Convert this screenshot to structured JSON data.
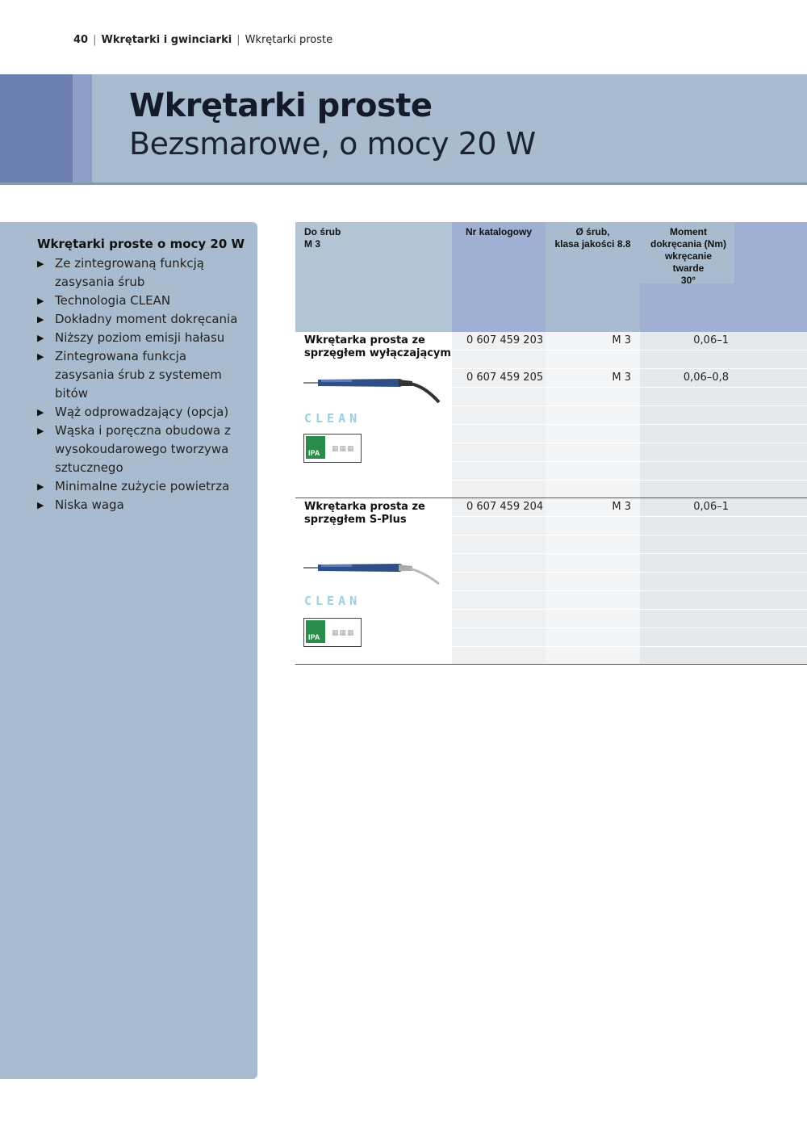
{
  "breadcrumb": {
    "page": "40",
    "section": "Wkrętarki i gwinciarki",
    "current": "Wkrętarki proste"
  },
  "header": {
    "title": "Wkrętarki proste",
    "subtitle": "Bezsmarowe, o mocy 20 W"
  },
  "sidebar": {
    "heading": "Wkrętarki proste o mocy 20 W",
    "bullet_icon": "triangle-right",
    "items": [
      "Ze zintegrowaną funkcją zasysania śrub",
      "Technologia CLEAN",
      "Dokładny moment dokręcania",
      "Niższy poziom emisji hałasu",
      "Zintegrowana funkcja zasysania śrub z systemem bitów",
      "Wąż odprowadzający (opcja)",
      "Wąska i poręczna obudowa z wysokoudarowego tworzywa sztucznego",
      "Minimalne zużycie powietrza",
      "Niska waga"
    ]
  },
  "table": {
    "headers": {
      "col1": [
        "Do śrub",
        "M 3"
      ],
      "col2": "Nr katalogowy",
      "col3": [
        "Ø śrub,",
        "klasa jakości 8.8"
      ],
      "col4": [
        "Moment",
        "dokręcania (Nm)",
        "wkręcanie",
        "twarde",
        "30°"
      ]
    },
    "groups": [
      {
        "name": [
          "Wkrętarka prosta ze",
          "sprzęgłem wyłączającym"
        ],
        "logo_text": "CLEAN",
        "badge_text": "IPA",
        "rows": [
          {
            "catalog": "0 607 459 203",
            "screw": "M 3",
            "torque": "0,06–1"
          },
          {
            "catalog": "0 607 459 205",
            "screw": "M 3",
            "torque": "0,06–0,8"
          }
        ]
      },
      {
        "name": [
          "Wkrętarka prosta ze",
          "sprzęgłem S-Plus"
        ],
        "logo_text": "CLEAN",
        "badge_text": "IPA",
        "rows": [
          {
            "catalog": "0 607 459 204",
            "screw": "M 3",
            "torque": "0,06–1"
          }
        ]
      }
    ]
  },
  "colors": {
    "banner": "#a9bccf",
    "banner_dark": "#6d7fb0",
    "sidebar": "#a9bccf",
    "header_alt": "#9fb0d3",
    "row_stripe": "#e6e9ec"
  }
}
